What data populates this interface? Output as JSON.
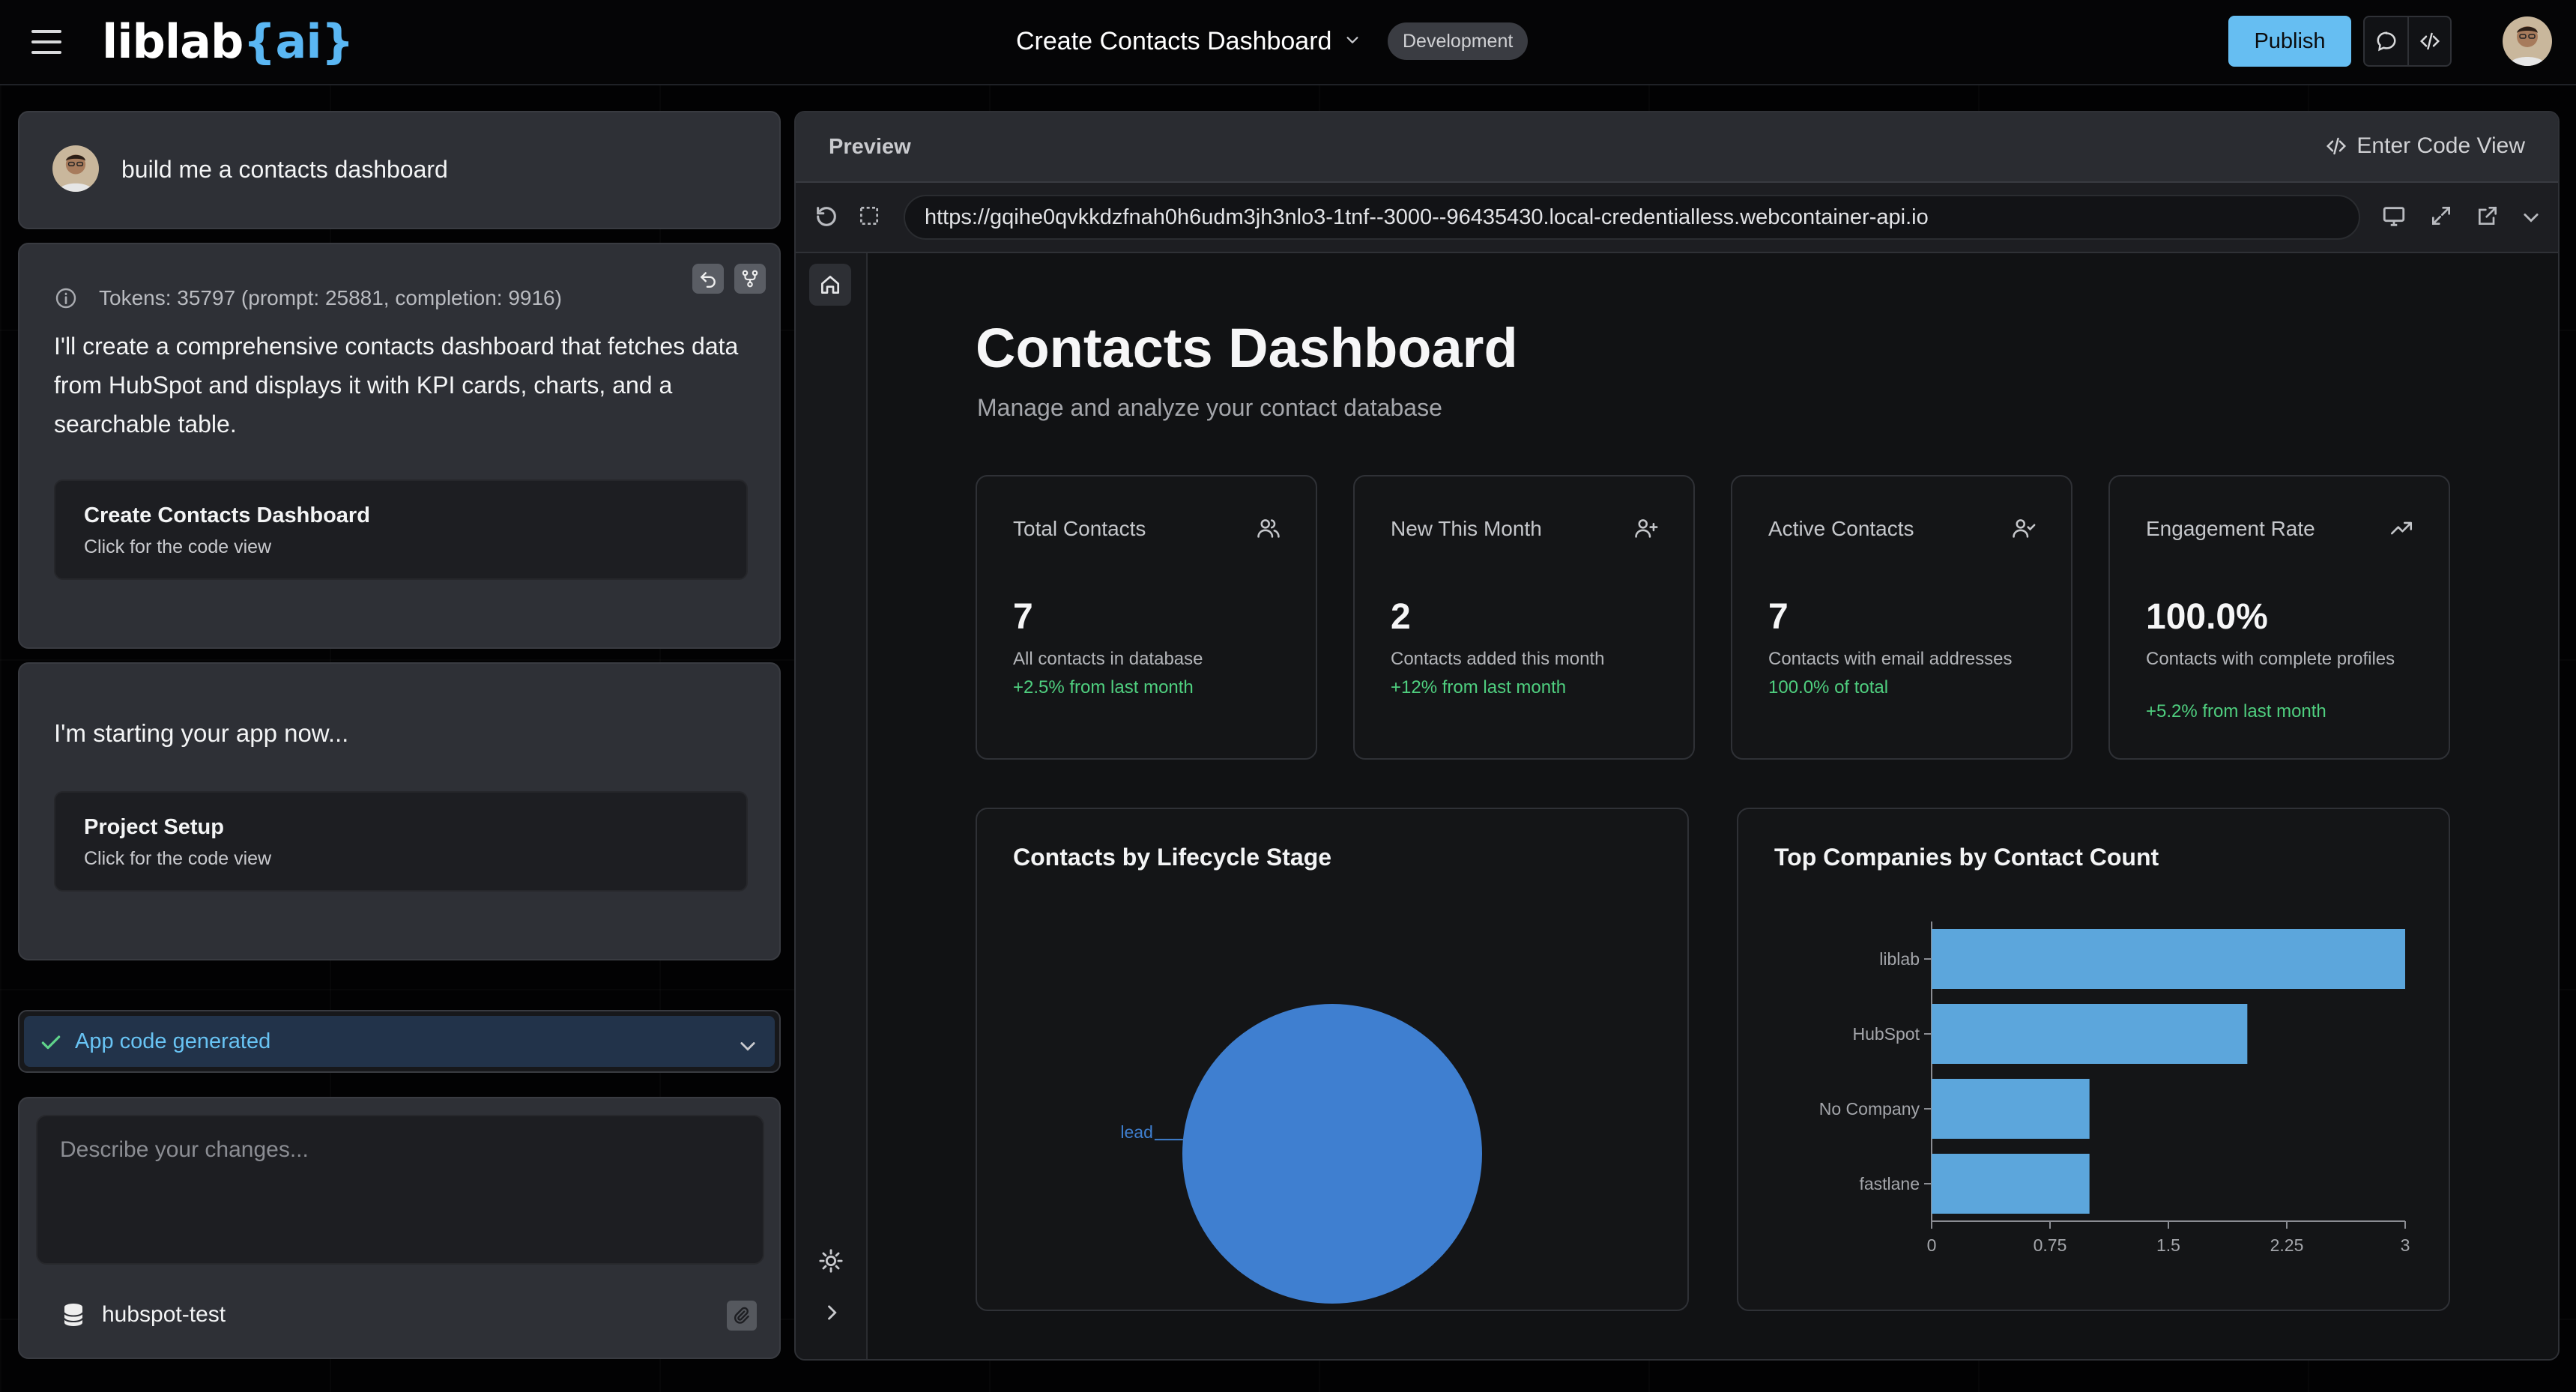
{
  "header": {
    "logo_main": "liblab",
    "logo_accent": "{ai}",
    "project_title": "Create Contacts Dashboard",
    "env_badge": "Development",
    "publish_label": "Publish"
  },
  "chat": {
    "user_message": "build me a contacts dashboard",
    "tokens": "Tokens: 35797 (prompt: 25881, completion: 9916)",
    "ai_message": "I'll create a comprehensive contacts dashboard that fetches data from HubSpot and displays it with KPI cards, charts, and a searchable table.",
    "artifact1": {
      "title": "Create Contacts Dashboard",
      "subtitle": "Click for the code view"
    },
    "start_message": "I'm starting your app now...",
    "artifact2": {
      "title": "Project Setup",
      "subtitle": "Click for the code view"
    },
    "status": "App code generated",
    "input_placeholder": "Describe your changes...",
    "datasource": "hubspot-test"
  },
  "preview": {
    "label": "Preview",
    "code_view_label": "Enter Code View",
    "url": "https://gqihe0qvkkdzfnah0h6udm3jh3nlo3-1tnf--3000--96435430.local-credentialless.webcontainer-api.io"
  },
  "app": {
    "title": "Contacts Dashboard",
    "subtitle": "Manage and analyze your contact database",
    "kpis": [
      {
        "label": "Total Contacts",
        "icon": "users-icon",
        "value": "7",
        "desc": "All contacts in database",
        "delta": "+2.5% from last month"
      },
      {
        "label": "New This Month",
        "icon": "user-plus-icon",
        "value": "2",
        "desc": "Contacts added this month",
        "delta": "+12% from last month"
      },
      {
        "label": "Active Contacts",
        "icon": "user-check-icon",
        "value": "7",
        "desc": "Contacts with email addresses",
        "delta": "100.0% of total"
      },
      {
        "label": "Engagement Rate",
        "icon": "trending-up-icon",
        "value": "100.0%",
        "desc": "Contacts with complete profiles",
        "delta": "+5.2% from last month"
      }
    ]
  },
  "chart_data": [
    {
      "type": "pie",
      "title": "Contacts by Lifecycle Stage",
      "categories": [
        "lead"
      ],
      "values": [
        7
      ],
      "colors": [
        "#3f7fd0"
      ]
    },
    {
      "type": "bar",
      "orientation": "horizontal",
      "title": "Top Companies by Contact Count",
      "categories": [
        "liblab",
        "HubSpot",
        "No Company",
        "fastlane"
      ],
      "values": [
        3,
        2,
        1,
        1
      ],
      "xlim": [
        0,
        3
      ],
      "ticks": [
        "0",
        "0.75",
        "1.5",
        "2.25",
        "3"
      ],
      "color": "#5ca6dc"
    }
  ],
  "colors": {
    "accent": "#66bef2",
    "positive": "#4fcf7f",
    "pie": "#3f7fd0",
    "bar": "#5ca6dc"
  }
}
